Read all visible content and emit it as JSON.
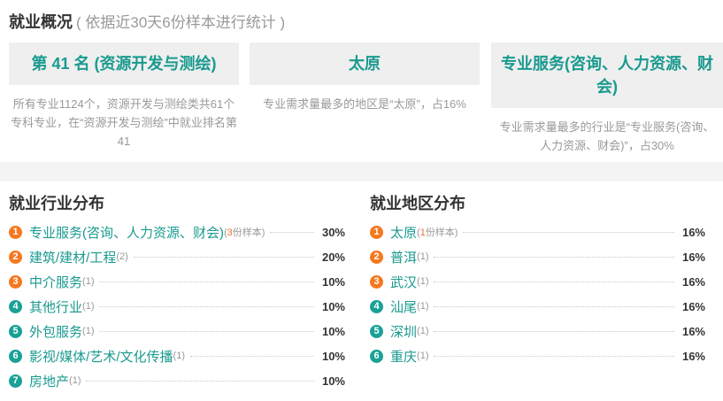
{
  "colors": {
    "accent": "#1a9a8f",
    "badge_top": "#f5781f",
    "badge": "#19a196",
    "count_highlight": "#f36b2a",
    "muted": "#999999",
    "card_bg": "#efefef",
    "band_bg": "#f4f4f4"
  },
  "overview": {
    "title": "就业概况",
    "subtitle": "( 依据近30天6份样本进行统计 )",
    "cards": [
      {
        "headline": "第 41 名 (资源开发与测绘)",
        "desc": "所有专业1124个，资源开发与测绘类共61个专科专业，在“资源开发与测绘”中就业排名第41"
      },
      {
        "headline": "太原",
        "desc": "专业需求量最多的地区是“太原”，占16%"
      },
      {
        "headline": "专业服务(咨询、人力资源、财会)",
        "desc": "专业需求量最多的行业是“专业服务(咨询、人力资源、财会)”，占30%"
      }
    ]
  },
  "industry": {
    "title": "就业行业分布",
    "items": [
      {
        "rank": "1",
        "name": "专业服务(咨询、人力资源、财会)",
        "note": {
          "pre": "(",
          "count": "3",
          "post": "份样本)",
          "highlight": true
        },
        "pct": "30%"
      },
      {
        "rank": "2",
        "name": "建筑/建材/工程",
        "note": {
          "pre": "(",
          "count": "2",
          "post": ")",
          "highlight": false
        },
        "pct": "20%"
      },
      {
        "rank": "3",
        "name": "中介服务",
        "note": {
          "pre": "(",
          "count": "1",
          "post": ")",
          "highlight": false
        },
        "pct": "10%"
      },
      {
        "rank": "4",
        "name": "其他行业",
        "note": {
          "pre": "(",
          "count": "1",
          "post": ")",
          "highlight": false
        },
        "pct": "10%"
      },
      {
        "rank": "5",
        "name": "外包服务",
        "note": {
          "pre": "(",
          "count": "1",
          "post": ")",
          "highlight": false
        },
        "pct": "10%"
      },
      {
        "rank": "6",
        "name": "影视/媒体/艺术/文化传播",
        "note": {
          "pre": "(",
          "count": "1",
          "post": ")",
          "highlight": false
        },
        "pct": "10%"
      },
      {
        "rank": "7",
        "name": "房地产",
        "note": {
          "pre": "(",
          "count": "1",
          "post": ")",
          "highlight": false
        },
        "pct": "10%"
      }
    ]
  },
  "region": {
    "title": "就业地区分布",
    "items": [
      {
        "rank": "1",
        "name": "太原",
        "note": {
          "pre": "(",
          "count": "1",
          "post": "份样本)",
          "highlight": true
        },
        "pct": "16%"
      },
      {
        "rank": "2",
        "name": "普洱",
        "note": {
          "pre": "(",
          "count": "1",
          "post": ")",
          "highlight": false
        },
        "pct": "16%"
      },
      {
        "rank": "3",
        "name": "武汉",
        "note": {
          "pre": "(",
          "count": "1",
          "post": ")",
          "highlight": false
        },
        "pct": "16%"
      },
      {
        "rank": "4",
        "name": "汕尾",
        "note": {
          "pre": "(",
          "count": "1",
          "post": ")",
          "highlight": false
        },
        "pct": "16%"
      },
      {
        "rank": "5",
        "name": "深圳",
        "note": {
          "pre": "(",
          "count": "1",
          "post": ")",
          "highlight": false
        },
        "pct": "16%"
      },
      {
        "rank": "6",
        "name": "重庆",
        "note": {
          "pre": "(",
          "count": "1",
          "post": ")",
          "highlight": false
        },
        "pct": "16%"
      }
    ]
  }
}
